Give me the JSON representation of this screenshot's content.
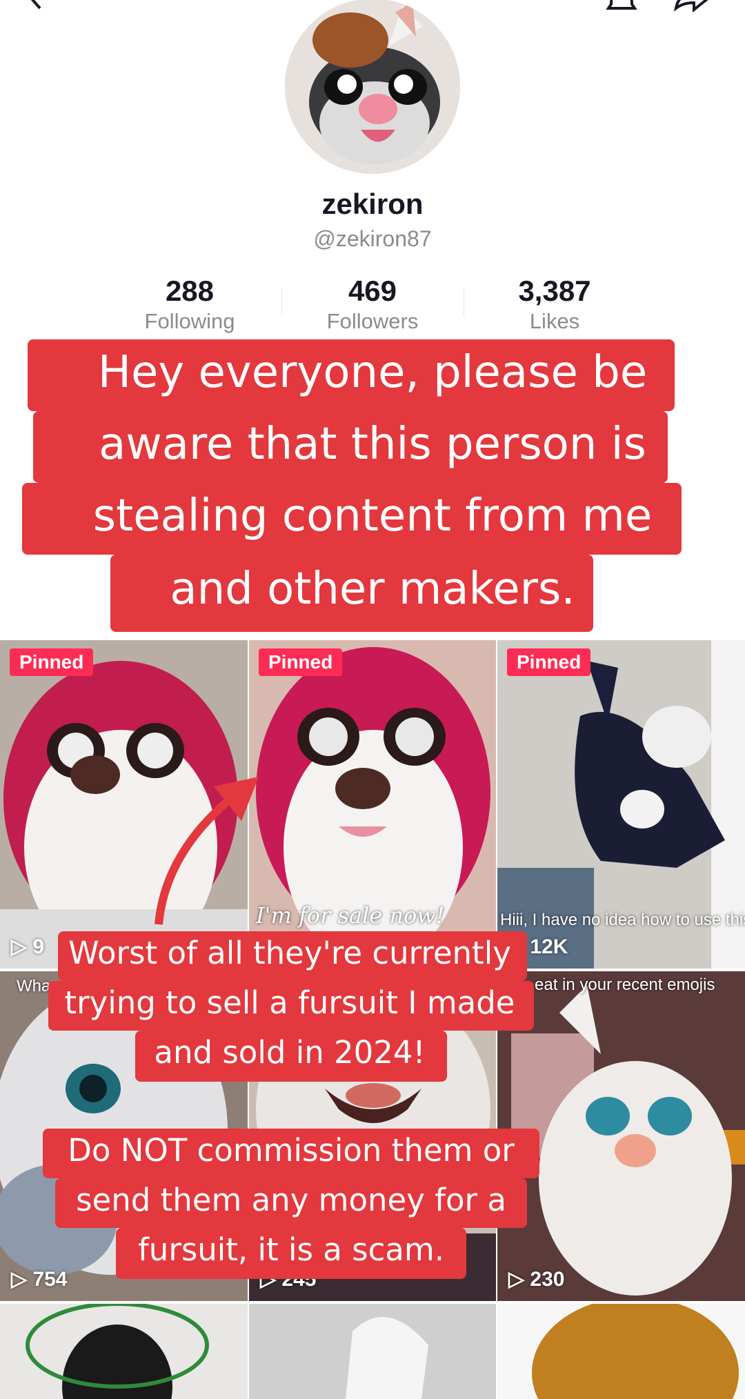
{
  "profile": {
    "display_name": "zekiron",
    "handle": "@zekiron87",
    "stats": [
      {
        "value": "288",
        "label": "Following"
      },
      {
        "value": "469",
        "label": "Followers"
      },
      {
        "value": "3,387",
        "label": "Likes"
      }
    ]
  },
  "overlay": {
    "top_lines": [
      "Hey everyone, please be",
      "aware that this person is",
      "stealing content from me",
      "and other makers."
    ],
    "middle_lines": [
      "Worst of all they're currently",
      "trying to sell a fursuit I made",
      "and sold in 2024!"
    ],
    "bottom_lines": [
      "Do NOT commission them or",
      "send them any money for a",
      "fursuit, it is a scam."
    ]
  },
  "videos": [
    {
      "pinned_label": "Pinned",
      "views": "9",
      "caption": ""
    },
    {
      "pinned_label": "Pinned",
      "views": "",
      "caption": "I'm for sale now!"
    },
    {
      "pinned_label": "Pinned",
      "views": "12K",
      "caption": "Hiii, I have no idea how to use this app"
    },
    {
      "pinned_label": "",
      "views": "754",
      "caption": "Wha"
    },
    {
      "pinned_label": "",
      "views": "245",
      "caption": ""
    },
    {
      "pinned_label": "",
      "views": "230",
      "caption": "eat in your recent emojis"
    }
  ],
  "colors": {
    "overlay_red": "#e3383d",
    "pinned_badge": "#fe2c55"
  },
  "icons": [
    "back-arrow-icon",
    "bell-icon",
    "share-icon",
    "play-icon",
    "red-arrow-annotation"
  ]
}
